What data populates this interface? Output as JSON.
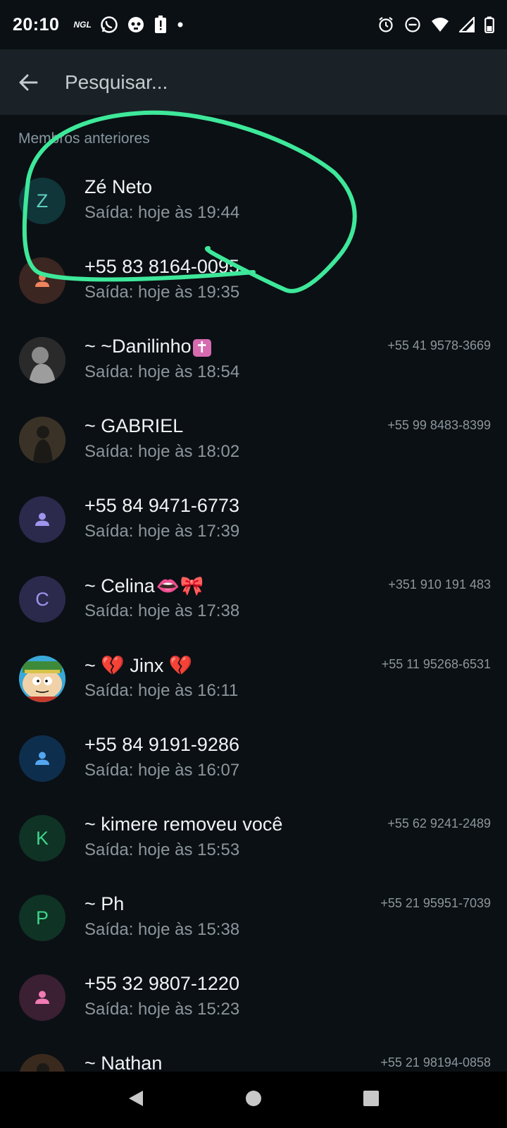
{
  "status_bar": {
    "time": "20:10",
    "ngl": "NGL",
    "icons_left": [
      "ngl-icon",
      "whatsapp-icon",
      "app-icon",
      "battery-alert-icon",
      "dot-icon"
    ],
    "icons_right": [
      "alarm-icon",
      "dnd-icon",
      "wifi-icon",
      "signal-icon",
      "battery-icon"
    ]
  },
  "search": {
    "placeholder": "Pesquisar..."
  },
  "section": {
    "label": "Membros anteriores"
  },
  "members": [
    {
      "name": "Zé Neto",
      "left": "Saída: hoje às 19:44",
      "phone": "",
      "avatar_letter": "Z",
      "avatar_type": "letter",
      "avatar_bg": "#10363a",
      "avatar_fg": "#5fcfbe"
    },
    {
      "name": "+55 83 8164-0095",
      "left": "Saída: hoje às 19:35",
      "phone": "",
      "avatar_letter": "",
      "avatar_type": "person",
      "avatar_bg": "#3b2621",
      "avatar_fg": "#f0855d"
    },
    {
      "name": "~ ~Danilinho",
      "name_emoji": "✝",
      "left": "Saída: hoje às 18:54",
      "phone": "+55 41 9578-3669",
      "avatar_letter": "",
      "avatar_type": "photo-dark",
      "avatar_bg": "#2a2a2a",
      "avatar_fg": "#bdbdbd"
    },
    {
      "name": "~ GABRIEL",
      "left": "Saída: hoje às 18:02",
      "phone": "+55 99 8483-8399",
      "avatar_letter": "",
      "avatar_type": "photo-brown",
      "avatar_bg": "#3a3226",
      "avatar_fg": "#1c1a17"
    },
    {
      "name": "+55 84 9471-6773",
      "left": "Saída: hoje às 17:39",
      "phone": "",
      "avatar_letter": "",
      "avatar_type": "person",
      "avatar_bg": "#2b2a4d",
      "avatar_fg": "#9f95ee"
    },
    {
      "name": "~ Celina",
      "name_emoji": "👄🎀",
      "left": "Saída: hoje às 17:38",
      "phone": "+351 910 191 483",
      "avatar_letter": "C",
      "avatar_type": "letter",
      "avatar_bg": "#2b2a4d",
      "avatar_fg": "#9f95ee"
    },
    {
      "name": "~ 💔 Jinx 💔",
      "left": "Saída: hoje às 16:11",
      "phone": "+55 11 95268-6531",
      "avatar_letter": "",
      "avatar_type": "cartoon",
      "avatar_bg": "#3aa8d8",
      "avatar_fg": "#f1d2a8"
    },
    {
      "name": "+55 84 9191-9286",
      "left": "Saída: hoje às 16:07",
      "phone": "",
      "avatar_letter": "",
      "avatar_type": "person",
      "avatar_bg": "#0e2e4d",
      "avatar_fg": "#53a6f0"
    },
    {
      "name": "~ kimere removeu você",
      "left": "Saída: hoje às 15:53",
      "phone": "+55 62 9241-2489",
      "avatar_letter": "K",
      "avatar_type": "letter",
      "avatar_bg": "#0f3324",
      "avatar_fg": "#3dd48a"
    },
    {
      "name": "~ Ph",
      "left": "Saída: hoje às 15:38",
      "phone": "+55 21 95951-7039",
      "avatar_letter": "P",
      "avatar_type": "letter",
      "avatar_bg": "#0f3324",
      "avatar_fg": "#3dd48a"
    },
    {
      "name": "+55 32 9807-1220",
      "left": "Saída: hoje às 15:23",
      "phone": "",
      "avatar_letter": "",
      "avatar_type": "person",
      "avatar_bg": "#3b1f33",
      "avatar_fg": "#f27bb6"
    },
    {
      "name": "~ Nathan",
      "left": "",
      "phone": "+55 21 98194-0858",
      "avatar_letter": "",
      "avatar_type": "photo-brown",
      "avatar_bg": "#3a2a1e",
      "avatar_fg": "#1c1a17"
    }
  ],
  "colors": {
    "annotation": "#3ee89a",
    "background": "#0b1014",
    "header": "#1b2227"
  },
  "nav": {
    "icons": [
      "back-triangle-icon",
      "home-circle-icon",
      "recents-square-icon"
    ]
  }
}
